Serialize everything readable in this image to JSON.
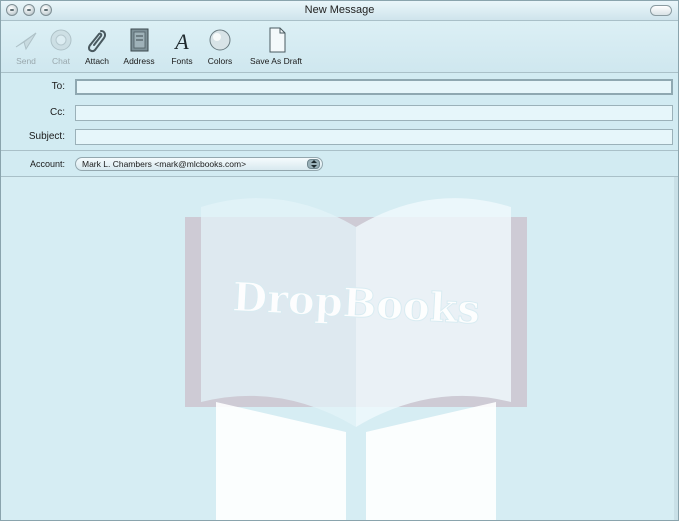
{
  "window": {
    "title": "New Message"
  },
  "toolbar": {
    "buttons": [
      {
        "label": "Send",
        "icon": "send-icon",
        "enabled": false
      },
      {
        "label": "Chat",
        "icon": "chat-icon",
        "enabled": false
      },
      {
        "label": "Attach",
        "icon": "paperclip-icon",
        "enabled": true
      },
      {
        "label": "Address",
        "icon": "address-book-icon",
        "enabled": true
      },
      {
        "label": "Fonts",
        "icon": "font-icon",
        "enabled": true
      },
      {
        "label": "Colors",
        "icon": "color-wheel-icon",
        "enabled": true
      },
      {
        "label": "Save As Draft",
        "icon": "draft-document-icon",
        "enabled": true
      }
    ]
  },
  "header": {
    "to_label": "To:",
    "to_value": "",
    "cc_label": "Cc:",
    "cc_value": "",
    "subject_label": "Subject:",
    "subject_value": ""
  },
  "account": {
    "label": "Account:",
    "selected": "Mark L. Chambers <mark@mlcbooks.com>"
  },
  "watermark": {
    "text": "DropBooks"
  },
  "colors": {
    "window_bg": "#d6edf3",
    "chrome_border": "#a9c0c8"
  }
}
